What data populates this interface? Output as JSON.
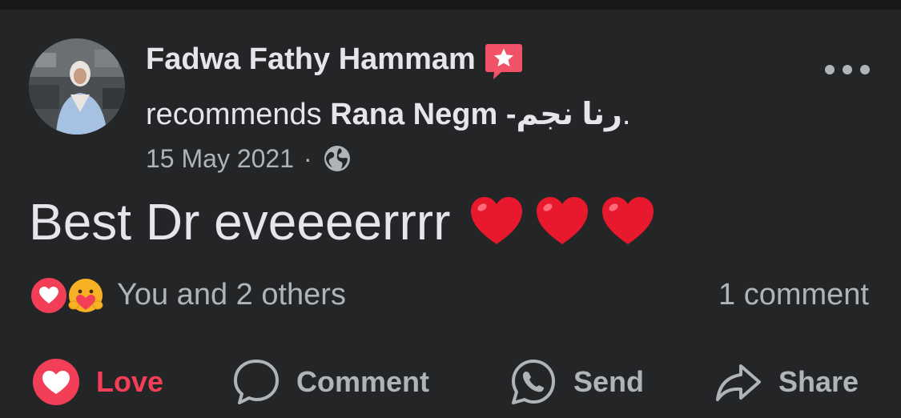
{
  "post": {
    "author_name": "Fadwa Fathy Hammam",
    "recommend_verb": "recommends",
    "recommended_page": "Rana Negm -رنا نجم",
    "recommend_suffix": ".",
    "date": "15 May 2021",
    "separator": "·",
    "privacy_icon": "globe-icon",
    "body": "Best Dr eveeeerrrr",
    "emoji": [
      "red-heart",
      "red-heart",
      "red-heart"
    ]
  },
  "reactions": {
    "icons": [
      "love-reaction-icon",
      "care-reaction-icon"
    ],
    "text": "You and 2 others",
    "comment_count": "1 comment"
  },
  "actions": {
    "love": "Love",
    "comment": "Comment",
    "send": "Send",
    "share": "Share"
  },
  "colors": {
    "background": "#242526",
    "text_primary": "#e4e6eb",
    "text_secondary": "#b0b3b8",
    "love_red": "#f33e58",
    "recommend_badge": "#f25268"
  }
}
